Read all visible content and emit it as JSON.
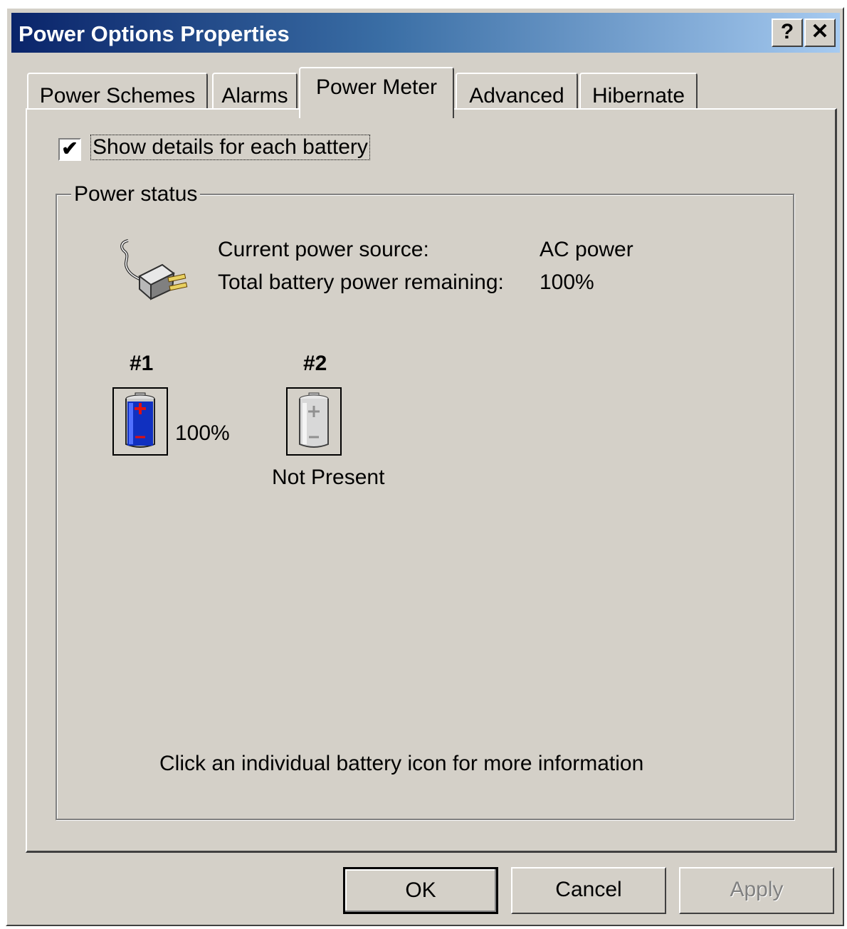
{
  "window": {
    "title": "Power Options Properties",
    "help_label": "?",
    "close_label": "✕"
  },
  "tabs": [
    {
      "label": "Power Schemes"
    },
    {
      "label": "Alarms"
    },
    {
      "label": "Power Meter",
      "active": true
    },
    {
      "label": "Advanced"
    },
    {
      "label": "Hibernate"
    }
  ],
  "power_meter": {
    "show_details": {
      "label": "Show details for each battery",
      "checked": true,
      "mark": "✔"
    },
    "group_title": "Power status",
    "source_label": "Current power source:",
    "source_value": "AC power",
    "remaining_label": "Total battery power remaining:",
    "remaining_value": "100%",
    "batteries": [
      {
        "number": "#1",
        "status": "100%",
        "charge": 1.0
      },
      {
        "number": "#2",
        "status": "Not Present"
      }
    ],
    "hint": "Click an individual battery icon for more information"
  },
  "buttons": {
    "ok": "OK",
    "cancel": "Cancel",
    "apply": "Apply"
  },
  "icons": [
    "ac-plug-icon",
    "battery-full-icon",
    "battery-not-present-icon",
    "checkmark-icon"
  ],
  "colors": {
    "title_start": "#0a246a",
    "title_end": "#a6caf0",
    "face": "#d4d0c8",
    "battery_blue": "#1030c0",
    "battery_plus": "#e01010"
  }
}
